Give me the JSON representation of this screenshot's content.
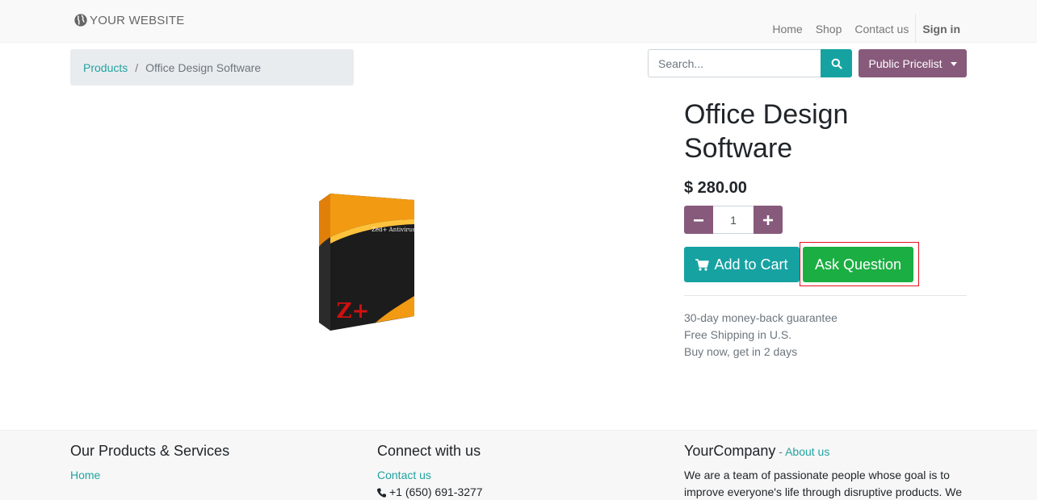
{
  "header": {
    "brand": "YOUR WEBSITE",
    "nav": [
      "Home",
      "Shop",
      "Contact us"
    ],
    "signin": "Sign in"
  },
  "breadcrumb": {
    "link": "Products",
    "separator": "/",
    "current": "Office Design Software"
  },
  "search": {
    "placeholder": "Search..."
  },
  "pricelist": {
    "label": "Public Pricelist"
  },
  "product": {
    "title": "Office Design Software",
    "price": "$ 280.00",
    "quantity": "1",
    "image_label": "Zed+ Antivirus",
    "image_logo": "Z+"
  },
  "actions": {
    "add_to_cart": "Add to Cart",
    "ask_question": "Ask Question"
  },
  "perks": [
    "30-day money-back guarantee",
    "Free Shipping in U.S.",
    "Buy now, get in 2 days"
  ],
  "footer": {
    "col1": {
      "title": "Our Products & Services",
      "link": "Home"
    },
    "col2": {
      "title": "Connect with us",
      "link": "Contact us",
      "phone": "+1 (650) 691-3277"
    },
    "col3": {
      "company": "YourCompany",
      "dash": " - ",
      "about": "About us",
      "text": "We are a team of passionate people whose goal is to improve everyone's life through disruptive products. We"
    }
  },
  "colors": {
    "primary": "#875a7b",
    "teal": "#17a2a2",
    "green": "#1bae43",
    "highlight": "#e8101c"
  }
}
